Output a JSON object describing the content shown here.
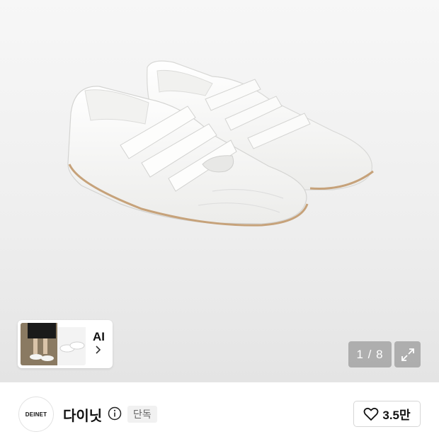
{
  "gallery": {
    "image_alt": "white velcro sneakers",
    "page_current": "1",
    "page_total": "8",
    "page_counter": "1 / 8"
  },
  "ai_card": {
    "label": "AI"
  },
  "brand": {
    "logo_text": "DEINET",
    "name": "다이닛",
    "badge": "단독"
  },
  "like": {
    "count": "3.5만"
  },
  "colors": {
    "accent_text": "#111111",
    "overlay_button": "#969696",
    "badge_bg": "#f1f1f1"
  },
  "icons": [
    "chevron-right-icon",
    "expand-icon",
    "info-icon",
    "heart-icon"
  ]
}
